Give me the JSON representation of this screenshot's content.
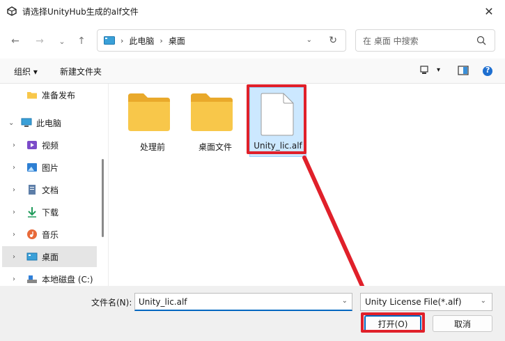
{
  "window": {
    "title": "请选择UnityHub生成的alf文件",
    "close_glyph": "✕"
  },
  "nav": {
    "back_glyph": "←",
    "forward_glyph": "→",
    "recent_glyph": "⌄",
    "up_glyph": "↑",
    "breadcrumbs": [
      "此电脑",
      "桌面"
    ],
    "separator": "›",
    "dropdown_glyph": "⌄",
    "refresh_glyph": "↻"
  },
  "search": {
    "placeholder": "在 桌面 中搜索"
  },
  "toolbar": {
    "organize_label": "组织",
    "organize_arrow": "▾",
    "new_folder_label": "新建文件夹",
    "view_arrow": "▾",
    "help_glyph": "?"
  },
  "sidebar": {
    "expand_glyph": "›",
    "collapse_glyph": "⌄",
    "items": [
      {
        "label": "准备发布",
        "icon": "folder-icon"
      },
      {
        "label": "此电脑",
        "icon": "computer-icon"
      },
      {
        "label": "视频",
        "icon": "video-icon"
      },
      {
        "label": "图片",
        "icon": "picture-icon"
      },
      {
        "label": "文档",
        "icon": "document-icon"
      },
      {
        "label": "下载",
        "icon": "download-icon"
      },
      {
        "label": "音乐",
        "icon": "music-icon"
      },
      {
        "label": "桌面",
        "icon": "desktop-icon"
      },
      {
        "label": "本地磁盘 (C:)",
        "icon": "drive-icon"
      }
    ]
  },
  "files": [
    {
      "label": "处理前",
      "type": "folder"
    },
    {
      "label": "桌面文件",
      "type": "folder"
    },
    {
      "label": "Unity_lic.alf",
      "type": "file"
    }
  ],
  "bottom": {
    "filename_label": "文件名(N):",
    "filename_value": "Unity_lic.alf",
    "filetype_value": "Unity License File(*.alf)",
    "dropdown_glyph": "⌄",
    "open_label": "打开(O)",
    "cancel_label": "取消"
  },
  "colors": {
    "accent": "#0067c0",
    "annotation_red": "#e0202a",
    "folder_yellow": "#f8c74a",
    "selection": "#cce8ff"
  }
}
